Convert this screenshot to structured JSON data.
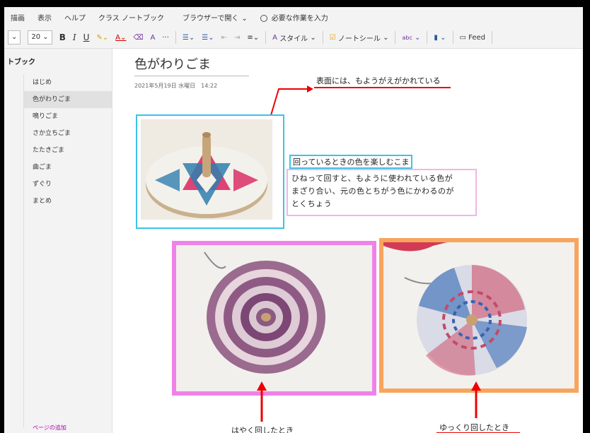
{
  "menu": {
    "items": [
      "描画",
      "表示",
      "ヘルプ",
      "クラス ノートブック",
      "ブラウザーで開く",
      "必要な作業を入力"
    ]
  },
  "toolbar": {
    "font_size": "20",
    "bold": "B",
    "italic": "I",
    "underline": "U",
    "more": "···",
    "style_label": "スタイル",
    "note_tag_label": "ノートシール",
    "spell_label": "abc",
    "feed_label": "Feed"
  },
  "sidebar": {
    "heading": "トブック",
    "pages": [
      "はじめ",
      "色がわりごま",
      "鳴りごま",
      "さか立ちごま",
      "たたきごま",
      "曲ごま",
      "ずぐり",
      "まとめ"
    ],
    "footer": "ページの追加"
  },
  "page": {
    "title": "色がわりごま",
    "date": "2021年5月19日 水曜日　14:22",
    "label_top": "表面には、もようがえがかれている",
    "label_blue": "回っているときの色を楽しむこま",
    "desc_lines": [
      "ひねって回すと、もように使われている色が",
      "まざり合い、元の色とちがう色にかわるのが",
      "とくちょう"
    ],
    "label_fast": "はやく回したとき",
    "label_slow": "ゆっくり回したとき"
  },
  "colors": {
    "cyan_frame": "#3cc3e6",
    "pink_frame": "#ee82e8",
    "orange_frame": "#f7a55e",
    "pink_box": "#f3b6e3",
    "annotation_red": "#e00000"
  }
}
